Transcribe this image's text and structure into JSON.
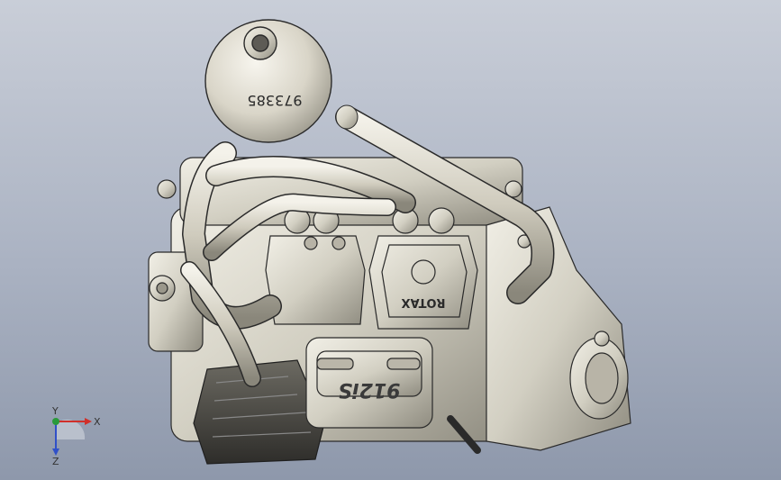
{
  "viewport": {
    "background_top": "#c9ced8",
    "background_bottom": "#8e98ab"
  },
  "model": {
    "reservoir_part_number": "973385",
    "valve_cover_logo": "ROTAX",
    "intake_manifold_label": "912iS",
    "metal_color": "#d6d3c7",
    "edge_color": "#2a2a2a"
  },
  "triad": {
    "x_label": "X",
    "y_label": "Y",
    "z_label": "Z",
    "x_color": "#d0302a",
    "y_color": "#2a9a3a",
    "z_color": "#3050c8"
  }
}
